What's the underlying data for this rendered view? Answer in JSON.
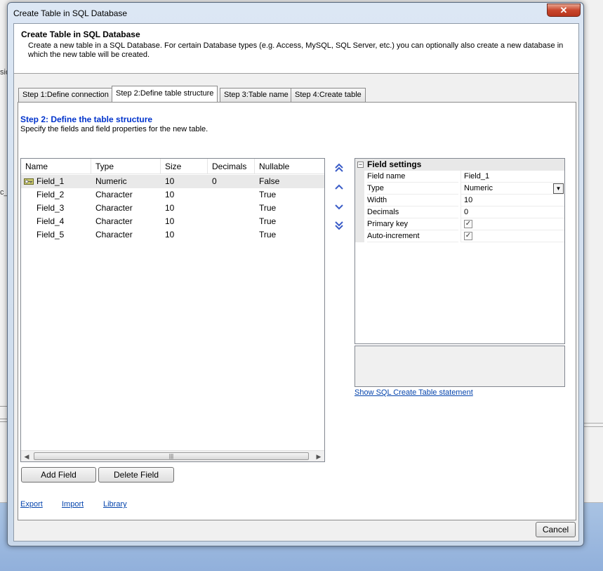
{
  "background": {
    "fragments": [
      "sio",
      "c_"
    ]
  },
  "window": {
    "title": "Create Table in SQL Database",
    "close_glyph": "✕"
  },
  "header": {
    "title": "Create Table in SQL Database",
    "description": "Create a new table in a SQL Database. For certain Database types (e.g. Access, MySQL, SQL Server, etc.) you can optionally also create a new database in which the new table will be created."
  },
  "tabs": [
    {
      "label": "Step 1:Define connection",
      "active": false
    },
    {
      "label": "Step 2:Define table structure",
      "active": true
    },
    {
      "label": "Step 3:Table name",
      "active": false
    },
    {
      "label": "Step 4:Create table",
      "active": false
    }
  ],
  "step": {
    "title": "Step 2: Define the table structure",
    "description": "Specify the fields and field properties for the new table."
  },
  "fields_table": {
    "columns": [
      "Name",
      "Type",
      "Size",
      "Decimals",
      "Nullable"
    ],
    "rows": [
      {
        "name": "Field_1",
        "type": "Numeric",
        "size": "10",
        "decimals": "0",
        "nullable": "False",
        "primary_key": true,
        "selected": true
      },
      {
        "name": "Field_2",
        "type": "Character",
        "size": "10",
        "decimals": "",
        "nullable": "True",
        "primary_key": false,
        "selected": false
      },
      {
        "name": "Field_3",
        "type": "Character",
        "size": "10",
        "decimals": "",
        "nullable": "True",
        "primary_key": false,
        "selected": false
      },
      {
        "name": "Field_4",
        "type": "Character",
        "size": "10",
        "decimals": "",
        "nullable": "True",
        "primary_key": false,
        "selected": false
      },
      {
        "name": "Field_5",
        "type": "Character",
        "size": "10",
        "decimals": "",
        "nullable": "True",
        "primary_key": false,
        "selected": false
      }
    ],
    "scrollbar_grip": "|||"
  },
  "move_buttons": [
    "move-to-top-icon",
    "move-up-icon",
    "move-down-icon",
    "move-to-bottom-icon"
  ],
  "field_settings": {
    "category": "Field settings",
    "collapse_glyph": "−",
    "properties": [
      {
        "name": "Field name",
        "value": "Field_1",
        "kind": "text"
      },
      {
        "name": "Type",
        "value": "Numeric",
        "kind": "dropdown"
      },
      {
        "name": "Width",
        "value": "10",
        "kind": "text"
      },
      {
        "name": "Decimals",
        "value": "0",
        "kind": "text"
      },
      {
        "name": "Primary key",
        "value": "✓",
        "kind": "checkbox"
      },
      {
        "name": "Auto-increment",
        "value": "✓",
        "kind": "checkbox"
      }
    ],
    "dropdown_glyph": "▼"
  },
  "sql_link": "Show SQL Create Table statement",
  "buttons": {
    "add_field": "Add Field",
    "delete_field": "Delete Field",
    "cancel": "Cancel"
  },
  "links": {
    "export": "Export",
    "import": "Import",
    "library": "Library"
  },
  "colors": {
    "step_title": "#0033cc",
    "link": "#0645ad",
    "close_button": "#c9462c"
  }
}
